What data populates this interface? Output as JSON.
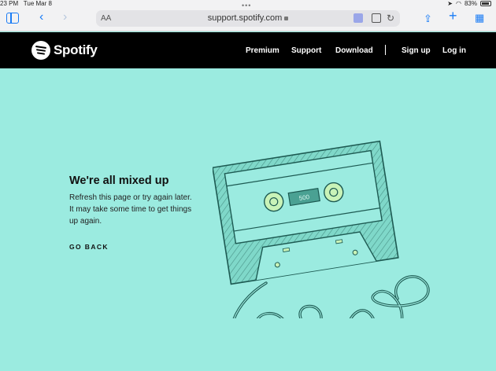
{
  "status_bar": {
    "time": "23 PM",
    "date": "Tue Mar 8",
    "battery": "83%"
  },
  "browser": {
    "url_label_small": "AA",
    "url": "support.spotify.com"
  },
  "site": {
    "brand": "Spotify",
    "nav": [
      "Premium",
      "Support",
      "Download",
      "Sign up",
      "Log in"
    ]
  },
  "error": {
    "title": "We're all mixed up",
    "message": "Refresh this page or try again later. It may take some time to get things up again.",
    "link": "GO BACK"
  },
  "illustration": {
    "counter": "500"
  },
  "colors": {
    "background": "#9bebe0",
    "header": "#000000",
    "cassette_stroke": "#1d5a52"
  }
}
